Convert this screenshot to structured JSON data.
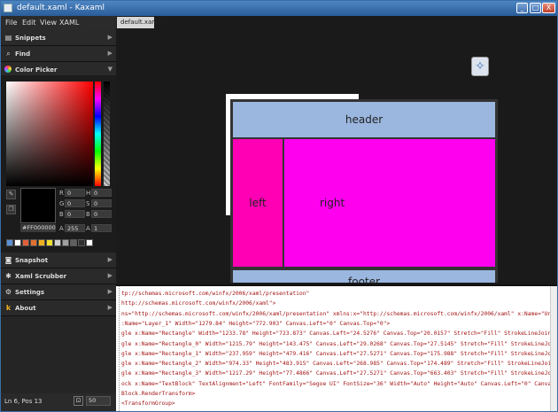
{
  "window": {
    "title": "default.xaml - Kaxaml",
    "min": "_",
    "max": "□",
    "close": "X"
  },
  "menu": {
    "file": "File",
    "edit": "Edit",
    "view": "View",
    "xaml": "XAML"
  },
  "sidebar": {
    "snippets": "Snippets",
    "find": "Find",
    "color_picker": "Color Picker",
    "snapshot": "Snapshot",
    "xaml_scrubber": "Xaml Scrubber",
    "settings": "Settings",
    "about": "About"
  },
  "color": {
    "r_label": "R",
    "r": "0",
    "h_label": "H",
    "h": "0",
    "g_label": "G",
    "g": "0",
    "s_label": "S",
    "s": "0",
    "b_label": "B",
    "b": "0",
    "bb_label": "B",
    "bb": "0",
    "hex": "#FF000000",
    "a_label": "A",
    "a": "255",
    "a2_label": "A",
    "a2": "1",
    "palette": [
      "#5b8fd4",
      "#ffffff",
      "#e0603a",
      "#e07030",
      "#f0b020",
      "#f0e030",
      "#d0d0d0",
      "#a0a0a0",
      "#606060",
      "#303030",
      "#ffffff"
    ]
  },
  "status": {
    "pos": "Ln 6, Pos 13",
    "zoom": "50"
  },
  "doc": {
    "tab": "default.xaml*"
  },
  "design": {
    "header": "header",
    "left": "left",
    "right": "right",
    "footer": "footer"
  },
  "code": [
    "tp://schemas.microsoft.com/winfx/2006/xaml/presentation\"",
    "http://schemas.microsoft.com/winfx/2006/xaml\">",
    "ns=\"http://schemas.microsoft.com/winfx/2006/xaml/presentation\" xmlns:x=\"http://schemas.microsoft.com/winfx/2006/xaml\" x:Name=\"Untitled1\" Wi",
    ":Name=\"Layer_1\" Width=\"1279.84\" Height=\"772.903\" Canvas.Left=\"0\" Canvas.Top=\"0\">",
    "gle x:Name=\"Rectangle\" Width=\"1233.78\" Height=\"723.873\" Canvas.Left=\"24.5276\" Canvas.Top=\"20.0157\" Stretch=\"Fill\" StrokeLineJoin=\"Round\" St",
    "gle x:Name=\"Rectangle_0\" Width=\"1215.79\" Height=\"143.475\" Canvas.Left=\"29.0268\" Canvas.Top=\"27.5145\" Stretch=\"Fill\" StrokeLineJoin=\"Round\"",
    "gle x:Name=\"Rectangle_1\" Width=\"237.959\" Height=\"479.416\" Canvas.Left=\"27.5271\" Canvas.Top=\"175.988\" Stretch=\"Fill\" StrokeLineJoin=\"Round\"",
    "gle x:Name=\"Rectangle_2\" Width=\"974.33\" Height=\"483.915\" Canvas.Left=\"268.985\" Canvas.Top=\"174.489\" Stretch=\"Fill\" StrokeLineJoin=\"Round\" S",
    "gle x:Name=\"Rectangle_3\" Width=\"1217.29\" Height=\"77.4866\" Canvas.Left=\"27.5271\" Canvas.Top=\"663.403\" Stretch=\"Fill\" StrokeLineJoin=\"Round\"",
    "ock x:Name=\"TextBlock\" TextAlignment=\"Left\" FontFamily=\"Segoe UI\" FontSize=\"36\" Width=\"Auto\" Height=\"Auto\" Canvas.Left=\"0\" Canvas.Top=\"0\">",
    "Block.RenderTransform>",
    "<TransformGroup>"
  ]
}
